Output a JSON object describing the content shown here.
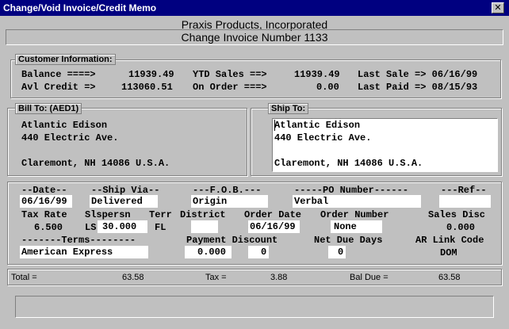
{
  "window": {
    "title": "Change/Void Invoice/Credit Memo",
    "close_glyph": "✕"
  },
  "header": {
    "company": "Praxis Products, Incorporated",
    "subtitle": "Change Invoice Number 1133"
  },
  "customer": {
    "legend": "Customer Information:",
    "balance_label": "Balance ====>",
    "balance_value": "11939.49",
    "ytd_label": "YTD Sales ==>",
    "ytd_value": "11939.49",
    "last_sale_label": "Last Sale => 06/16/99",
    "avl_label": "Avl Credit =>",
    "avl_value": "113060.51",
    "on_order_label": "On Order ===>",
    "on_order_value": "0.00",
    "last_paid_label": "Last Paid => 08/15/93"
  },
  "bill_to": {
    "legend": "Bill To: (AED1)",
    "lines": [
      "Atlantic Edison",
      "440 Electric Ave.",
      "",
      "Claremont, NH 14086 U.S.A."
    ]
  },
  "ship_to": {
    "legend": "Ship To:",
    "lines": [
      "Atlantic Edison",
      "440 Electric Ave.",
      "",
      "Claremont, NH 14086 U.S.A."
    ]
  },
  "order": {
    "date_label": "--Date--",
    "date_value": "06/16/99",
    "ship_via_label": "--Ship Via--",
    "ship_via_value": "Delivered",
    "fob_label": "---F.O.B.---",
    "fob_value": "Origin",
    "po_label": "-----PO Number------",
    "po_value": "Verbal",
    "ref_label": "---Ref--",
    "ref_value": "",
    "tax_rate_label": "Tax Rate",
    "tax_rate_value": "6.500",
    "slspersn_label": "Slspersn",
    "slspersn_code": "LS",
    "slspersn_value": "30.000",
    "terr_label": "Terr",
    "terr_value": "FL",
    "district_label": "District",
    "district_value": "",
    "order_date_label": "Order Date",
    "order_date_value": "06/16/99",
    "order_number_label": "Order Number",
    "order_number_value": "None",
    "sales_disc_label": "Sales Disc",
    "sales_disc_value": "0.000",
    "terms_label": "-------Terms--------",
    "terms_value": "American Express",
    "payment_discount_label": "Payment Discount",
    "payment_discount_value": "0.000",
    "payment_discount_days": "0",
    "net_due_label": "Net Due Days",
    "net_due_value": "0",
    "ar_link_label": "AR Link Code",
    "ar_link_value": "DOM"
  },
  "totals": {
    "total_label": "Total =",
    "total_value": "63.58",
    "tax_label": "Tax =",
    "tax_value": "3.88",
    "bal_due_label": "Bal Due =",
    "bal_due_value": "63.58"
  },
  "status": {
    "text": ""
  }
}
